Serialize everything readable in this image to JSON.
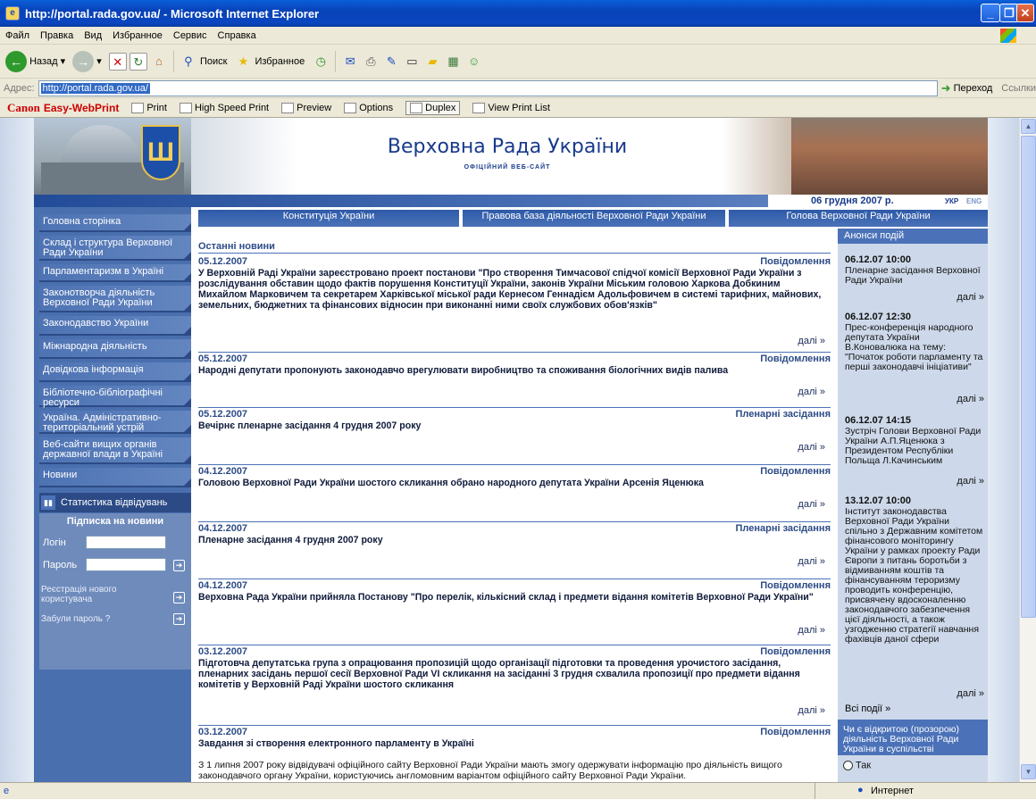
{
  "window": {
    "title": "http://portal.rada.gov.ua/ - Microsoft Internet Explorer"
  },
  "menu": [
    "Файл",
    "Правка",
    "Вид",
    "Избранное",
    "Сервис",
    "Справка"
  ],
  "toolbar": {
    "back": "Назад",
    "search": "Поиск",
    "favorites": "Избранное"
  },
  "address": {
    "label": "Адрес:",
    "url": "http://portal.rada.gov.ua/",
    "go": "Переход",
    "links": "Ссылки"
  },
  "canonbar": {
    "brand": "Canon",
    "product": "Easy-WebPrint",
    "print": "Print",
    "high_speed": "High Speed Print",
    "preview": "Preview",
    "options": "Options",
    "duplex": "Duplex",
    "view_list": "View Print List"
  },
  "site": {
    "title": "Верховна Рада України",
    "subtitle": "ОФІЦІЙНИЙ ВЕБ-САЙТ",
    "date": "06 грудня 2007 р.",
    "lang_ukr": "УКР",
    "lang_eng": "ENG"
  },
  "sidebar": [
    "Головна сторінка",
    "Склад і структура Верховної Ради України",
    "Парламентаризм в Україні",
    "Законотворча діяльність Верховної Ради України",
    "Законодавство України",
    "Міжнародна діяльність",
    "Довідкова інформація",
    "Бібліотечно-бібліографічні ресурси",
    "Україна. Адміністративно-територіальний устрій",
    "Веб-сайти вищих органів державної влади в Україні",
    "Новини"
  ],
  "stats": "Статистика відвідувань",
  "subscribe": {
    "title": "Підписка на новини",
    "login": "Логін",
    "password": "Пароль",
    "register": "Реєстрація нового користувача",
    "forgot": "Забули пароль ?"
  },
  "nav": [
    "Конституція України",
    "Правова база діяльності Верховної Ради України",
    "Голова Верховної Ради України"
  ],
  "news": {
    "heading": "Останні новини",
    "more": "далі »",
    "items": [
      {
        "date": "05.12.2007",
        "cat": "Повідомлення",
        "title": "У Верховній Раді України зареєстровано проект постанови \"Про створення Тимчасової спідчої комісії Верховної Ради України з розслідування обставин щодо фактів порушення Конституції України, законів України Міським головою Харкова Добкиним Михайлом Марковичем та секретарем Харківської міської ради Кернесом Геннадієм Адольфовичем в системі тарифних, майнових, земельних, бюджетних та фінансових відносин при виконанні ними своїх службових обов'язків\""
      },
      {
        "date": "05.12.2007",
        "cat": "Повідомлення",
        "title": "Народні депутати пропонують законодавчо врегулювати виробництво та споживання біологічних видів палива"
      },
      {
        "date": "05.12.2007",
        "cat": "Пленарні засідання",
        "title": "Вечірнє пленарне засідання 4 грудня 2007 року"
      },
      {
        "date": "04.12.2007",
        "cat": "Повідомлення",
        "title": "Головою Верховної Ради України шостого скликання обрано народного депутата України Арсенія Яценюка"
      },
      {
        "date": "04.12.2007",
        "cat": "Пленарні засідання",
        "title": "Пленарне засідання 4 грудня 2007 року"
      },
      {
        "date": "04.12.2007",
        "cat": "Повідомлення",
        "title": "Верховна Рада України прийняла Постанову \"Про перелік, кількісний склад і предмети відання комітетів Верховної Ради України\""
      },
      {
        "date": "03.12.2007",
        "cat": "Повідомлення",
        "title": "Підготовча депутатська група з опрацювання пропозицій щодо організації підготовки та проведення урочистого засідання, пленарних засідань першої сесії Верховної Ради VI скликання на засіданні 3 грудня схвалила пропозиції про предмети відання комітетів у Верховній Раді України шостого скликання"
      },
      {
        "date": "03.12.2007",
        "cat": "Повідомлення",
        "title": "Завдання зі створення електронного парламенту в Україні",
        "text": "З 1 липня 2007 року відвідувачі офіційного сайту Верховної Ради України мають змогу одержувати інформацію про діяльність вищого законодавчого органу України, користуючись англомовним варіантом офіційного сайту Верховної Ради України."
      }
    ]
  },
  "events": {
    "heading": "Анонси подій",
    "more": "далі »",
    "all": "Всі події »",
    "items": [
      {
        "time": "06.12.07 10:00",
        "text": "Пленарне засідання Верховної Ради України"
      },
      {
        "time": "06.12.07 12:30",
        "text": "Прес-конференція народного депутата України В.Коновалюка на тему: \"Початок роботи парламенту та перші законодавчі ініціативи\""
      },
      {
        "time": "06.12.07 14:15",
        "text": "Зустріч Голови Верховної Ради України А.П.Яценюка з Президентом Республіки Польща Л.Качинським"
      },
      {
        "time": "13.12.07 10:00",
        "text": "Інститут законодавства Верховної Ради України спільно з Державним комітетом фінансового моніторингу України у рамках проекту Ради Європи з питань боротьби з відмиванням коштів та фінансуванням тероризму проводить конференцію, присвячену вдосконаленню законодавчого забезпечення цієї діяльності, а також узгодженню стратегії навчання фахівців даної сфери"
      }
    ]
  },
  "poll": {
    "question": "Чи є відкритою (прозорою) діяльність Верховної Ради України в суспільстві",
    "option": "Так"
  },
  "status": {
    "zone": "Интернет"
  }
}
